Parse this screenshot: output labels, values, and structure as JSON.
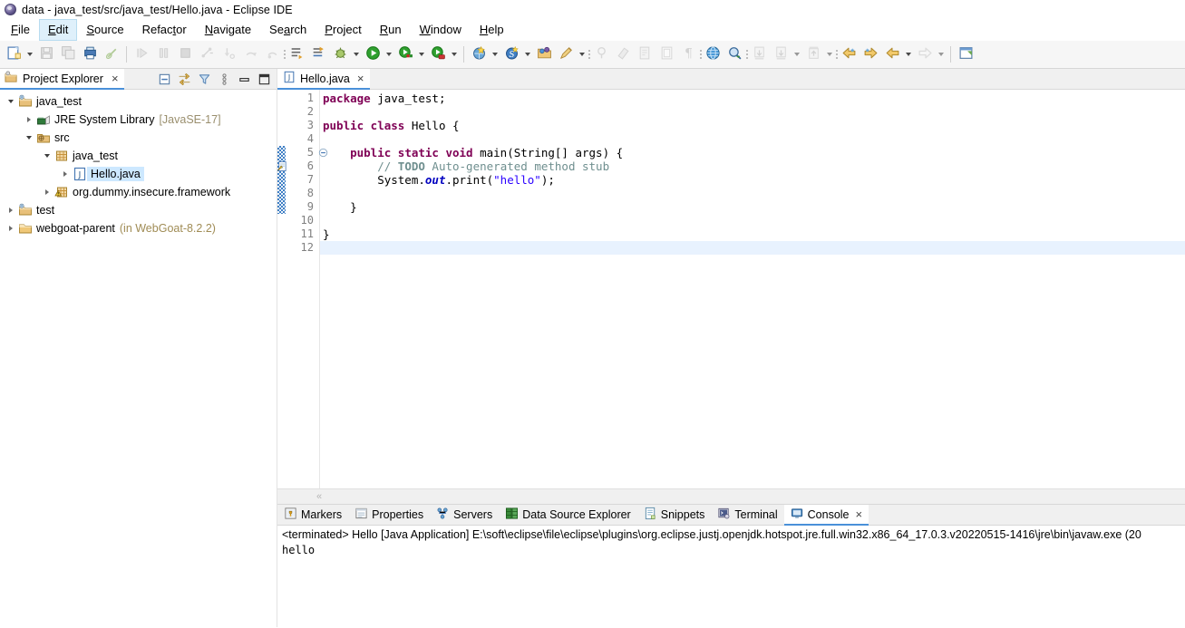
{
  "window": {
    "title": "data - java_test/src/java_test/Hello.java - Eclipse IDE",
    "app_icon": "eclipse-icon"
  },
  "menubar": {
    "items": [
      {
        "label": "File",
        "mnemonic_index": 0,
        "hover": false
      },
      {
        "label": "Edit",
        "mnemonic_index": 0,
        "hover": true
      },
      {
        "label": "Source",
        "mnemonic_index": 0,
        "hover": false
      },
      {
        "label": "Refactor",
        "mnemonic_index": 5,
        "hover": false
      },
      {
        "label": "Navigate",
        "mnemonic_index": 0,
        "hover": false
      },
      {
        "label": "Search",
        "mnemonic_index": 2,
        "hover": false
      },
      {
        "label": "Project",
        "mnemonic_index": 0,
        "hover": false
      },
      {
        "label": "Run",
        "mnemonic_index": 0,
        "hover": false
      },
      {
        "label": "Window",
        "mnemonic_index": 0,
        "hover": false
      },
      {
        "label": "Help",
        "mnemonic_index": 0,
        "hover": false
      }
    ]
  },
  "toolbar": {
    "groups": [
      {
        "buttons": [
          {
            "name": "new-wizard",
            "caret": true,
            "enabled": true
          },
          {
            "name": "save",
            "caret": false,
            "enabled": false
          },
          {
            "name": "save-all",
            "caret": false,
            "enabled": false
          },
          {
            "name": "print",
            "caret": false,
            "enabled": true
          },
          {
            "name": "quick-access-toggle",
            "caret": false,
            "enabled": false
          }
        ]
      },
      {
        "buttons": [
          {
            "name": "resume",
            "caret": false,
            "enabled": false
          },
          {
            "name": "suspend",
            "caret": false,
            "enabled": false
          },
          {
            "name": "terminate",
            "caret": false,
            "enabled": false
          },
          {
            "name": "disconnect",
            "caret": false,
            "enabled": false
          },
          {
            "name": "step-into",
            "caret": false,
            "enabled": false
          },
          {
            "name": "step-over",
            "caret": false,
            "enabled": false
          },
          {
            "name": "step-return",
            "caret": false,
            "enabled": false
          }
        ]
      },
      {
        "buttons": [
          {
            "name": "next-annotation",
            "caret": false,
            "enabled": true
          },
          {
            "name": "previous-annotation",
            "caret": false,
            "enabled": true
          },
          {
            "name": "debug",
            "caret": true,
            "enabled": true
          },
          {
            "name": "run",
            "caret": true,
            "enabled": true
          },
          {
            "name": "coverage",
            "caret": true,
            "enabled": true
          },
          {
            "name": "run-external-tools",
            "caret": true,
            "enabled": true
          }
        ]
      },
      {
        "buttons": [
          {
            "name": "new-java-project",
            "caret": true,
            "enabled": true
          },
          {
            "name": "new-package",
            "caret": true,
            "enabled": true
          },
          {
            "name": "open-type",
            "caret": false,
            "enabled": true
          },
          {
            "name": "open-task",
            "caret": true,
            "enabled": true
          }
        ]
      },
      {
        "buttons": [
          {
            "name": "new-marker",
            "caret": false,
            "enabled": false
          },
          {
            "name": "eraser",
            "caret": false,
            "enabled": false
          },
          {
            "name": "new-file-wizard",
            "caret": false,
            "enabled": false
          },
          {
            "name": "toggle-block-selection",
            "caret": false,
            "enabled": false
          },
          {
            "name": "show-whitespace",
            "caret": false,
            "enabled": false
          }
        ]
      },
      {
        "buttons": [
          {
            "name": "open-web-browser",
            "caret": false,
            "enabled": true
          },
          {
            "name": "search-dialog",
            "caret": false,
            "enabled": true
          }
        ]
      },
      {
        "buttons": [
          {
            "name": "download-1",
            "caret": false,
            "enabled": false
          },
          {
            "name": "download-2",
            "caret": true,
            "enabled": false
          },
          {
            "name": "upload",
            "caret": true,
            "enabled": false
          }
        ]
      },
      {
        "buttons": [
          {
            "name": "previous-edit-location",
            "caret": false,
            "enabled": true
          },
          {
            "name": "next-edit-location",
            "caret": false,
            "enabled": true
          },
          {
            "name": "back",
            "caret": true,
            "enabled": true
          },
          {
            "name": "forward",
            "caret": true,
            "enabled": false
          }
        ]
      },
      {
        "buttons": [
          {
            "name": "open-perspective",
            "caret": false,
            "enabled": true
          }
        ]
      }
    ]
  },
  "project_explorer": {
    "tab_label": "Project Explorer",
    "tab_icon": "project-explorer-icon",
    "close_icon": "×",
    "view_actions": [
      {
        "name": "collapse-all-icon"
      },
      {
        "name": "link-with-editor-icon"
      },
      {
        "name": "filter-icon"
      },
      {
        "name": "view-menu-icon"
      },
      {
        "name": "minimize-icon"
      },
      {
        "name": "maximize-icon"
      }
    ],
    "tree": [
      {
        "label": "java_test",
        "icon": "java-project-icon",
        "indent": 0,
        "state": "expanded",
        "selected": false,
        "suffix": ""
      },
      {
        "label": "JRE System Library",
        "icon": "library-icon",
        "indent": 1,
        "state": "collapsed",
        "selected": false,
        "suffix": "[JavaSE-17]"
      },
      {
        "label": "src",
        "icon": "source-folder-icon",
        "indent": 1,
        "state": "expanded",
        "selected": false,
        "suffix": ""
      },
      {
        "label": "java_test",
        "icon": "package-icon",
        "indent": 2,
        "state": "expanded",
        "selected": false,
        "suffix": ""
      },
      {
        "label": "Hello.java",
        "icon": "java-file-icon",
        "indent": 3,
        "state": "collapsed",
        "selected": true,
        "suffix": ""
      },
      {
        "label": "org.dummy.insecure.framework",
        "icon": "package-warning-icon",
        "indent": 2,
        "state": "collapsed",
        "selected": false,
        "suffix": ""
      },
      {
        "label": "test",
        "icon": "java-project-icon",
        "indent": 0,
        "state": "collapsed",
        "selected": false,
        "suffix": ""
      },
      {
        "label": "webgoat-parent",
        "icon": "folder-icon",
        "indent": 0,
        "state": "collapsed",
        "selected": false,
        "suffix": "(in WebGoat-8.2.2)"
      }
    ]
  },
  "editor": {
    "tab_label": "Hello.java",
    "tab_icon": "java-file-icon",
    "close_icon": "×",
    "scroll_left_icon": "«",
    "current_line": 12,
    "change_bar_lines": [
      5,
      9
    ],
    "marker_line": 6,
    "marker_name": "todo-task-marker-icon",
    "fold_line": 5,
    "lines": [
      {
        "num": 1,
        "tokens": [
          {
            "t": "package ",
            "c": "kw"
          },
          {
            "t": "java_test;",
            "c": ""
          }
        ]
      },
      {
        "num": 2,
        "tokens": []
      },
      {
        "num": 3,
        "tokens": [
          {
            "t": "public class ",
            "c": "kw"
          },
          {
            "t": "Hello {",
            "c": ""
          }
        ]
      },
      {
        "num": 4,
        "tokens": []
      },
      {
        "num": 5,
        "tokens": [
          {
            "t": "    ",
            "c": ""
          },
          {
            "t": "public static void ",
            "c": "kw"
          },
          {
            "t": "main(String[] args) {",
            "c": ""
          }
        ]
      },
      {
        "num": 6,
        "tokens": [
          {
            "t": "        // ",
            "c": "cmt"
          },
          {
            "t": "TODO",
            "c": "todo"
          },
          {
            "t": " Auto-generated method stub",
            "c": "cmt"
          }
        ]
      },
      {
        "num": 7,
        "tokens": [
          {
            "t": "        System.",
            "c": ""
          },
          {
            "t": "out",
            "c": "fld"
          },
          {
            "t": ".print(",
            "c": ""
          },
          {
            "t": "\"hello\"",
            "c": "str"
          },
          {
            "t": ");",
            "c": ""
          }
        ]
      },
      {
        "num": 8,
        "tokens": []
      },
      {
        "num": 9,
        "tokens": [
          {
            "t": "    }",
            "c": ""
          }
        ]
      },
      {
        "num": 10,
        "tokens": []
      },
      {
        "num": 11,
        "tokens": [
          {
            "t": "}",
            "c": ""
          }
        ]
      },
      {
        "num": 12,
        "tokens": []
      }
    ]
  },
  "bottom_panel": {
    "tabs": [
      {
        "label": "Markers",
        "icon": "markers-icon",
        "active": false,
        "closable": false
      },
      {
        "label": "Properties",
        "icon": "properties-icon",
        "active": false,
        "closable": false
      },
      {
        "label": "Servers",
        "icon": "servers-icon",
        "active": false,
        "closable": false
      },
      {
        "label": "Data Source Explorer",
        "icon": "data-source-explorer-icon",
        "active": false,
        "closable": false
      },
      {
        "label": "Snippets",
        "icon": "snippets-icon",
        "active": false,
        "closable": false
      },
      {
        "label": "Terminal",
        "icon": "terminal-icon",
        "active": false,
        "closable": false
      },
      {
        "label": "Console",
        "icon": "console-icon",
        "active": true,
        "closable": true
      }
    ],
    "console": {
      "header": "<terminated> Hello [Java Application] E:\\soft\\eclipse\\file\\eclipse\\plugins\\org.eclipse.justj.openjdk.hotspot.jre.full.win32.x86_64_17.0.3.v20220515-1416\\jre\\bin\\javaw.exe  (20",
      "output": "hello"
    }
  },
  "colors": {
    "accent": "#4a90d9",
    "selection": "#cde8ff",
    "current_line": "#e8f2fe",
    "keyword": "#7f0055",
    "string": "#2a00ff",
    "comment": "#6f8f8f",
    "field": "#0000c0",
    "change_bar": "#3f7fc4"
  }
}
